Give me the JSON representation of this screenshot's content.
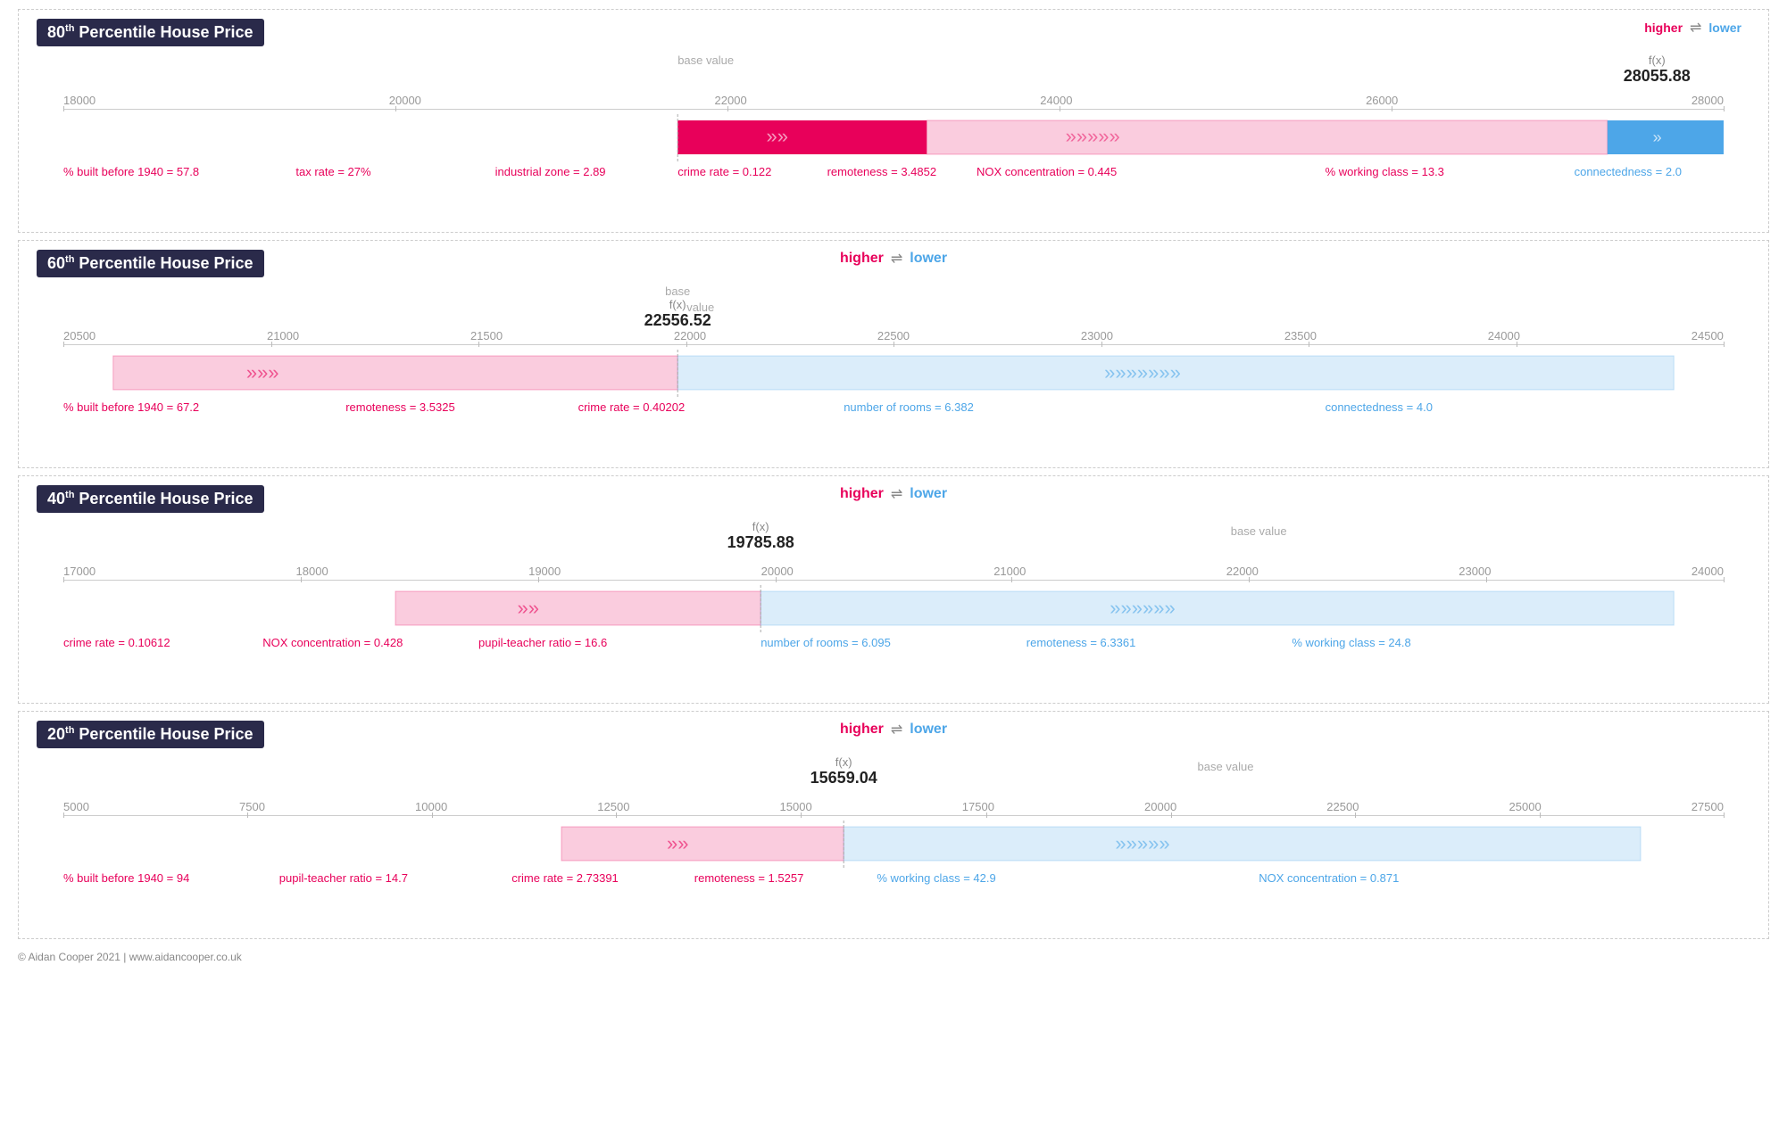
{
  "sections": [
    {
      "id": "p80",
      "title": "80",
      "superscript": "th",
      "suffix": " Percentile House Price",
      "fx_value": "28055.88",
      "fx_label": "f(x)",
      "base_label": "base value",
      "legend_position": "right",
      "axis_min": 18000,
      "axis_max": 28000,
      "axis_ticks": [
        "18000",
        "20000",
        "22000",
        "24000",
        "26000",
        "28000"
      ],
      "fx_position_pct": 93,
      "base_position_pct": 38,
      "bars": [
        {
          "start_pct": 37,
          "end_pct": 52,
          "type": "pink",
          "solid": true
        },
        {
          "start_pct": 52,
          "end_pct": 93,
          "type": "pink",
          "solid": false
        }
      ],
      "blue_bars": [
        {
          "start_pct": 93,
          "end_pct": 100,
          "type": "blue",
          "solid": true
        }
      ],
      "features_pink": [
        {
          "label": "% built before 1940 = 57.8",
          "pos_pct": 2
        },
        {
          "label": "tax rate = 27%",
          "pos_pct": 16
        },
        {
          "label": "industrial zone = 2.89",
          "pos_pct": 28
        },
        {
          "label": "crime rate = 0.122",
          "pos_pct": 39
        },
        {
          "label": "remoteness = 3.4852",
          "pos_pct": 49
        },
        {
          "label": "NOX concentration = 0.445",
          "pos_pct": 57
        },
        {
          "label": "% working class = 13.3",
          "pos_pct": 76
        }
      ],
      "features_blue": [
        {
          "label": "connectedness = 2.0",
          "pos_pct": 92
        }
      ]
    },
    {
      "id": "p60",
      "title": "60",
      "superscript": "th",
      "suffix": " Percentile House Price",
      "fx_value": "22556.52",
      "fx_label": "f(x)",
      "base_label": "base value",
      "legend_position": "center",
      "axis_min": 20500,
      "axis_max": 24500,
      "axis_ticks": [
        "20500",
        "21000",
        "21500",
        "22000",
        "22500",
        "23000",
        "23500",
        "24000",
        "24500"
      ],
      "fx_position_pct": 37,
      "base_position_pct": 37,
      "bars_pink": [
        {
          "start_pct": 3,
          "end_pct": 37,
          "solid": false
        }
      ],
      "bars_blue": [
        {
          "start_pct": 37,
          "end_pct": 97,
          "solid": false
        }
      ],
      "features_pink": [
        {
          "label": "% built before 1940 = 67.2",
          "pos_pct": 2
        },
        {
          "label": "remoteness = 3.5325",
          "pos_pct": 19
        },
        {
          "label": "crime rate = 0.40202",
          "pos_pct": 34
        }
      ],
      "features_blue": [
        {
          "label": "number of rooms = 6.382",
          "pos_pct": 50
        },
        {
          "label": "connectedness = 4.0",
          "pos_pct": 80
        }
      ]
    },
    {
      "id": "p40",
      "title": "40",
      "superscript": "th",
      "suffix": " Percentile House Price",
      "fx_value": "19785.88",
      "fx_label": "f(x)",
      "base_label": "base value",
      "legend_position": "center",
      "axis_min": 17000,
      "axis_max": 24000,
      "axis_ticks": [
        "17000",
        "18000",
        "19000",
        "20000",
        "21000",
        "22000",
        "23000",
        "24000"
      ],
      "fx_position_pct": 42,
      "base_position_pct": 72,
      "bars_pink": [
        {
          "start_pct": 20,
          "end_pct": 42,
          "solid": false
        }
      ],
      "bars_blue": [
        {
          "start_pct": 42,
          "end_pct": 97,
          "solid": false
        }
      ],
      "features_pink": [
        {
          "label": "crime rate = 0.10612",
          "pos_pct": 2
        },
        {
          "label": "NOX concentration = 0.428",
          "pos_pct": 14
        },
        {
          "label": "pupil-teacher ratio = 16.6",
          "pos_pct": 27
        }
      ],
      "features_blue": [
        {
          "label": "number of rooms = 6.095",
          "pos_pct": 44
        },
        {
          "label": "remoteness = 6.3361",
          "pos_pct": 60
        },
        {
          "label": "% working class = 24.8",
          "pos_pct": 76
        }
      ]
    },
    {
      "id": "p20",
      "title": "20",
      "superscript": "th",
      "suffix": " Percentile House Price",
      "fx_value": "15659.04",
      "fx_label": "f(x)",
      "base_label": "base value",
      "legend_position": "center",
      "axis_min": 5000,
      "axis_max": 27500,
      "axis_ticks": [
        "5000",
        "7500",
        "10000",
        "12500",
        "15000",
        "17500",
        "20000",
        "22500",
        "25000",
        "27500"
      ],
      "fx_position_pct": 47,
      "base_position_pct": 70,
      "bars_pink": [
        {
          "start_pct": 30,
          "end_pct": 47,
          "solid": false
        }
      ],
      "bars_blue": [
        {
          "start_pct": 47,
          "end_pct": 95,
          "solid": false
        }
      ],
      "features_pink": [
        {
          "label": "% built before 1940 = 94",
          "pos_pct": 2
        },
        {
          "label": "pupil-teacher ratio = 14.7",
          "pos_pct": 15
        },
        {
          "label": "crime rate = 2.73391",
          "pos_pct": 29
        },
        {
          "label": "remoteness = 1.5257",
          "pos_pct": 40
        }
      ],
      "features_blue": [
        {
          "label": "% working class = 42.9",
          "pos_pct": 50
        },
        {
          "label": "NOX concentration = 0.871",
          "pos_pct": 74
        }
      ]
    }
  ],
  "copyright": "© Aidan Cooper 2021 | www.aidancooper.co.uk",
  "legend": {
    "higher": "higher",
    "lower": "lower",
    "arrows": "⇌"
  }
}
